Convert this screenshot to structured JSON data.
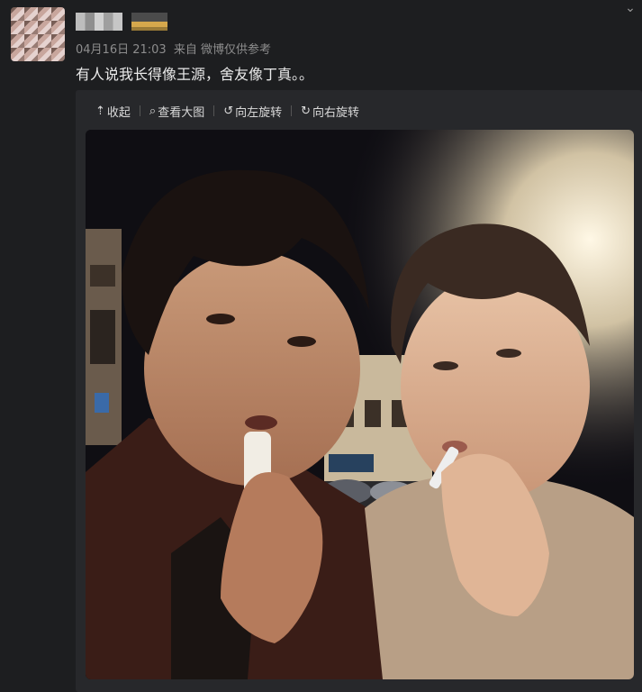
{
  "post": {
    "timestamp": "04月16日 21:03",
    "source": "来自 微博仅供参考",
    "text": "有人说我长得像王源，舍友像丁真。。"
  },
  "toolbar": {
    "collapse": {
      "icon": "up-arrow-icon",
      "label": "收起"
    },
    "view_large": {
      "icon": "magnifier-icon",
      "label": "查看大图"
    },
    "rotate_left": {
      "icon": "rotate-left-icon",
      "label": "向左旋转"
    },
    "rotate_right": {
      "icon": "rotate-right-icon",
      "label": "向右旋转"
    }
  },
  "colors": {
    "background": "#1d1e20",
    "panel": "#27282b",
    "meta_text": "#8d8d8d",
    "body_text": "#eaeaea"
  }
}
